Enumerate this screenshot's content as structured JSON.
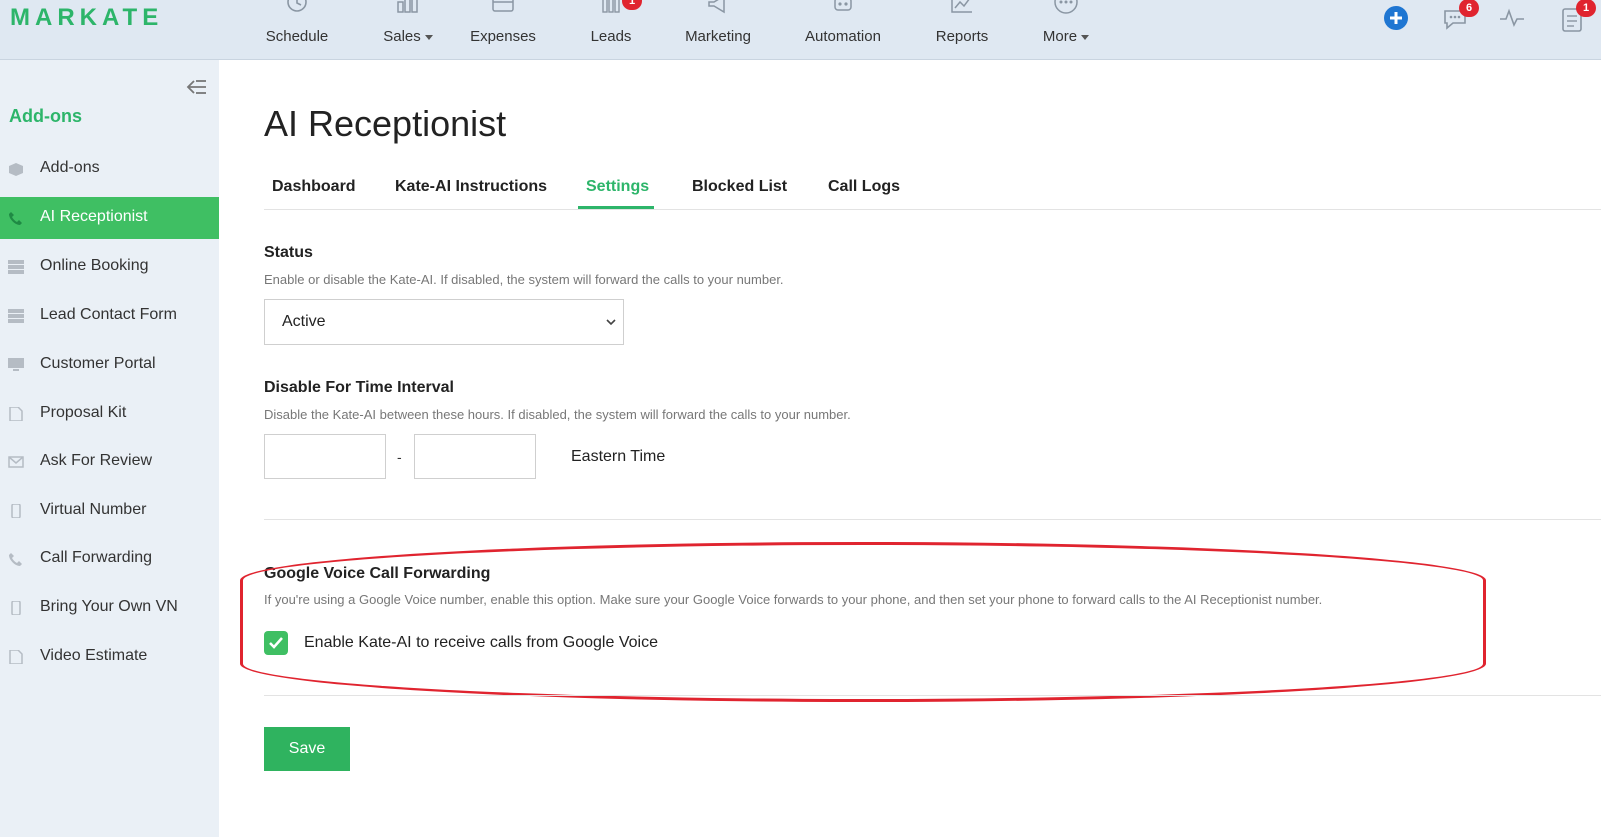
{
  "app": {
    "logo": "MARKATE"
  },
  "nav": {
    "items": [
      {
        "label": "Schedule",
        "icon": "clock-icon"
      },
      {
        "label": "Sales",
        "icon": "bar-chart-icon"
      },
      {
        "label": "Expenses",
        "icon": "wallet-icon"
      },
      {
        "label": "Leads",
        "icon": "funnel-bars-icon",
        "badge": "1"
      },
      {
        "label": "Marketing",
        "icon": "megaphone-icon"
      },
      {
        "label": "Automation",
        "icon": "robot-icon"
      },
      {
        "label": "Reports",
        "icon": "line-chart-icon"
      },
      {
        "label": "More",
        "icon": "more-dots-icon"
      }
    ],
    "right": {
      "messages_badge": "6",
      "tasks_badge": "1"
    }
  },
  "sidebar": {
    "title": "Add-ons",
    "items": [
      {
        "label": "Add-ons",
        "icon": "box-icon"
      },
      {
        "label": "AI Receptionist",
        "icon": "phone-icon",
        "active": true
      },
      {
        "label": "Online Booking",
        "icon": "server-icon"
      },
      {
        "label": "Lead Contact Form",
        "icon": "server-icon"
      },
      {
        "label": "Customer Portal",
        "icon": "monitor-icon"
      },
      {
        "label": "Proposal Kit",
        "icon": "document-icon"
      },
      {
        "label": "Ask For Review",
        "icon": "envelope-icon"
      },
      {
        "label": "Virtual Number",
        "icon": "mobile-icon"
      },
      {
        "label": "Call Forwarding",
        "icon": "phone-icon"
      },
      {
        "label": "Bring Your Own VN",
        "icon": "mobile-icon"
      },
      {
        "label": "Video Estimate",
        "icon": "document-icon"
      }
    ]
  },
  "main": {
    "title": "AI Receptionist",
    "tabs": [
      {
        "label": "Dashboard"
      },
      {
        "label": "Kate-AI Instructions"
      },
      {
        "label": "Settings",
        "active": true
      },
      {
        "label": "Blocked List"
      },
      {
        "label": "Call Logs"
      }
    ],
    "status": {
      "label": "Status",
      "help": "Enable or disable the Kate-AI. If disabled, the system will forward the calls to your number.",
      "value": "Active"
    },
    "interval": {
      "label": "Disable For Time Interval",
      "help": "Disable the Kate-AI between these hours. If disabled, the system will forward the calls to your number.",
      "start_value": "",
      "end_value": "",
      "separator": "-",
      "timezone": "Eastern Time"
    },
    "google_voice": {
      "label": "Google Voice Call Forwarding",
      "help": "If you're using a Google Voice number, enable this option. Make sure your Google Voice forwards to your phone, and then set your phone to forward calls to the AI Receptionist number.",
      "checkbox_label": "Enable Kate-AI to receive calls from Google Voice",
      "checked": true
    },
    "save_label": "Save"
  },
  "colors": {
    "brand_green": "#2db56a",
    "active_green": "#3fbf63",
    "highlight_red": "#e0242f",
    "nav_bg": "#dfe8f2",
    "sidebar_bg": "#eaf0f6"
  }
}
